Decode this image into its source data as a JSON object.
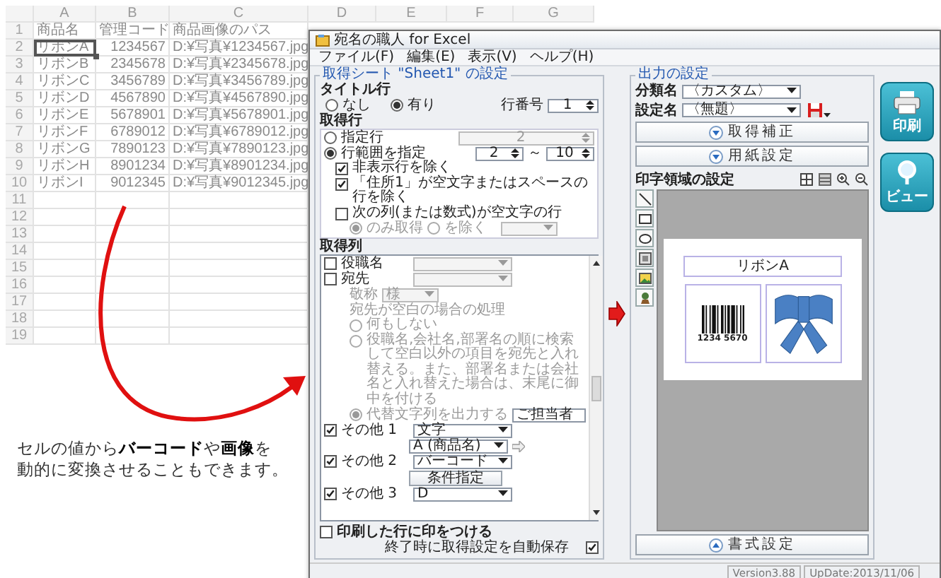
{
  "sheet": {
    "columns": [
      "A",
      "B",
      "C",
      "D",
      "E",
      "F",
      "G"
    ],
    "rows": [
      {
        "number": "1",
        "cells": [
          {
            "text": "商品名",
            "selected": false
          },
          {
            "text": "管理コード",
            "selected": false
          },
          {
            "text": "商品画像のパス",
            "selected": false
          }
        ]
      },
      {
        "number": "2",
        "cells": [
          {
            "text": "リボンA",
            "selected": true
          },
          {
            "text": "1234567",
            "selected": false
          },
          {
            "text": "D:¥写真¥1234567.jpg",
            "selected": false
          }
        ]
      },
      {
        "number": "3",
        "cells": [
          {
            "text": "リボンB",
            "selected": false
          },
          {
            "text": "2345678",
            "selected": false
          },
          {
            "text": "D:¥写真¥2345678.jpg",
            "selected": false
          }
        ]
      },
      {
        "number": "4",
        "cells": [
          {
            "text": "リボンC",
            "selected": false
          },
          {
            "text": "3456789",
            "selected": false
          },
          {
            "text": "D:¥写真¥3456789.jpg",
            "selected": false
          }
        ]
      },
      {
        "number": "5",
        "cells": [
          {
            "text": "リボンD",
            "selected": false
          },
          {
            "text": "4567890",
            "selected": false
          },
          {
            "text": "D:¥写真¥4567890.jpg",
            "selected": false
          }
        ]
      },
      {
        "number": "6",
        "cells": [
          {
            "text": "リボンE",
            "selected": false
          },
          {
            "text": "5678901",
            "selected": false
          },
          {
            "text": "D:¥写真¥5678901.jpg",
            "selected": false
          }
        ]
      },
      {
        "number": "7",
        "cells": [
          {
            "text": "リボンF",
            "selected": false
          },
          {
            "text": "6789012",
            "selected": false
          },
          {
            "text": "D:¥写真¥6789012.jpg",
            "selected": false
          }
        ]
      },
      {
        "number": "8",
        "cells": [
          {
            "text": "リボンG",
            "selected": false
          },
          {
            "text": "7890123",
            "selected": false
          },
          {
            "text": "D:¥写真¥7890123.jpg",
            "selected": false
          }
        ]
      },
      {
        "number": "9",
        "cells": [
          {
            "text": "リボンH",
            "selected": false
          },
          {
            "text": "8901234",
            "selected": false
          },
          {
            "text": "D:¥写真¥8901234.jpg",
            "selected": false
          }
        ]
      },
      {
        "number": "10",
        "cells": [
          {
            "text": "リボンI",
            "selected": false
          },
          {
            "text": "9012345",
            "selected": false
          },
          {
            "text": "D:¥写真¥9012345.jpg",
            "selected": false
          }
        ]
      },
      {
        "number": "11"
      },
      {
        "number": "12"
      },
      {
        "number": "13"
      },
      {
        "number": "14"
      },
      {
        "number": "15"
      },
      {
        "number": "16"
      },
      {
        "number": "17"
      },
      {
        "number": "18"
      },
      {
        "number": "19"
      }
    ]
  },
  "caption": [
    "セルの値から**バーコード**や**画像**を",
    "動的に変換させることもできます。"
  ],
  "app": {
    "title": "宛名の職人 for Excel",
    "menu": [
      "ファイル(F)",
      "編集(E)",
      "表示(V)",
      "ヘルプ(H)"
    ],
    "sheet_settings": {
      "title": "取得シート \"Sheet1\" の設定",
      "title_row": {
        "label": "タイトル行",
        "options": [
          {
            "label": "なし",
            "selected": false
          },
          {
            "label": "有り",
            "selected": true
          }
        ],
        "row_number_label": "行番号",
        "row_number": "1"
      },
      "rows_section": {
        "label": "取得行",
        "specified": {
          "label": "指定行",
          "selected": false,
          "value": "2"
        },
        "range": {
          "label": "行範囲を指定",
          "selected": true,
          "from": "2",
          "separator": "～",
          "to": "10"
        },
        "checks": [
          {
            "label": "非表示行を除く",
            "checked": true
          },
          {
            "label": "「住所1」が空文字またはスペースの行を除く",
            "checked": true
          },
          {
            "label": "次の列(または数式)が空文字の行",
            "checked": false
          }
        ],
        "empty_options": [
          {
            "label": "のみ取得",
            "selected": true,
            "disabled": true
          },
          {
            "label": "を除く",
            "selected": false,
            "disabled": true
          }
        ]
      },
      "columns_section": {
        "label": "取得列",
        "items": [
          {
            "kind": "check-select",
            "label": "役職名",
            "checked": false,
            "disabled": true
          },
          {
            "kind": "check-select",
            "label": "宛先",
            "checked": false,
            "disabled": true
          },
          {
            "kind": "select",
            "label": "敬称",
            "value": "様",
            "disabled": true
          },
          {
            "kind": "note",
            "label": "宛先が空白の場合の処理",
            "disabled": true
          },
          {
            "kind": "radio",
            "label": "何もしない",
            "selected": false,
            "disabled": true
          },
          {
            "kind": "radio",
            "label": "役職名,会社名,部署名の順に検索して空白以外の項目を宛先と入れ替える。また、部署名または会社名と入れ替えた場合は、末尾に御中を付ける",
            "selected": false,
            "disabled": true
          },
          {
            "kind": "radio-input",
            "label": "代替文字列を出力する",
            "selected": true,
            "value": "ご担当者",
            "disabled": true
          },
          {
            "kind": "check-select",
            "label": "その他 1",
            "checked": true,
            "value": "文字",
            "disabled": false
          },
          {
            "kind": "mapped-select",
            "value": "A (商品名)",
            "disabled": false
          },
          {
            "kind": "check-select",
            "label": "その他 2",
            "checked": true,
            "value": "バーコード",
            "disabled": false
          },
          {
            "kind": "button",
            "label": "条件指定",
            "disabled": false
          },
          {
            "kind": "check-select",
            "label": "その他 3",
            "checked": true,
            "value": "D",
            "disabled": false
          }
        ]
      },
      "mark_printed": {
        "label": "印刷した行に印をつける",
        "checked": false
      },
      "autosave": {
        "label": "終了時に取得設定を自動保存",
        "checked": true
      }
    },
    "output_settings": {
      "title": "出力の設定",
      "category_label": "分類名",
      "category": "〈カスタム〉",
      "setting_label": "設定名",
      "setting": "〈無題〉",
      "sections": [
        {
          "label": "取得補正",
          "expanded": false
        },
        {
          "label": "用紙設定",
          "expanded": false
        }
      ],
      "print_area_label": "印字領域の設定",
      "preview": {
        "text": "リボンA",
        "barcode_digits": "1234 5670"
      },
      "format_button": {
        "label": "書式設定",
        "expanded": true
      }
    },
    "actions": [
      {
        "label": "印刷",
        "kind": "print"
      },
      {
        "label": "ビュー",
        "kind": "view"
      }
    ],
    "status": [
      "Version3.88",
      "UpDate:2013/11/06"
    ]
  }
}
